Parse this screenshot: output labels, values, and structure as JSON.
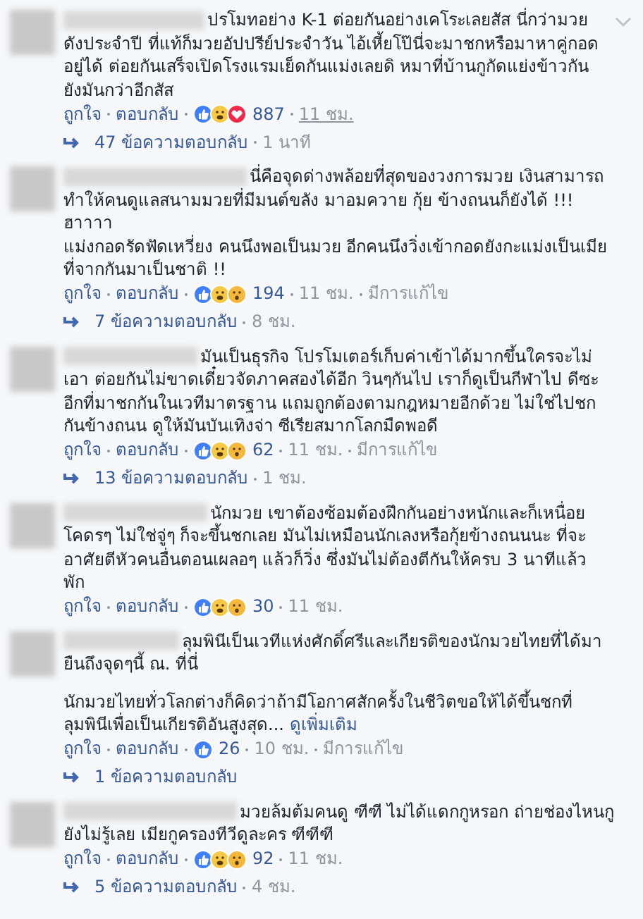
{
  "comments": [
    {
      "menu_visible": true,
      "paragraphs": [
        [
          "ปรโมทอย่าง K-1 ต่อยกันอย่างเคโระเลยสัส นี่กว่ามวย",
          "ดังประจำปี ที่แท้ก็มวยอัปปรีย์ประจำวัน ไอ้เหี้ยโป๊นี่จะมาชกหรือมาหาคู่กอด",
          "อยู่ได้ ต่อยกันเสร็จเปิดโรงแรมเย็ดกันแม่งเลยดิ หมาที่บ้านกูกัดแย่งข้าวกัน",
          "ยังมันกว่าอีกสัส"
        ]
      ],
      "like": "ถูกใจ",
      "reply": "ตอบกลับ",
      "reactions": [
        {
          "kind": "like"
        },
        {
          "kind": "haha"
        },
        {
          "kind": "love"
        }
      ],
      "count": "887",
      "time": "11 ชม.",
      "time_hovered": true,
      "replies": "47 ข้อความตอบกลับ",
      "replies_time": "1 นาที"
    },
    {
      "menu_visible": false,
      "paragraphs": [
        [
          "นี่คือจุดด่างพล้อยที่สุดของวงการมวย เงินสามารถ",
          "ทำให้คนดูแลสนามมวยที่มีมนต์ขลัง มาอมควาย กุ้ย ข้างถนนก็ยังได้ !!!",
          "ฮาาาา",
          "แม่งกอดรัดฟัดเหวี่ยง คนนึงพอเป็นมวย อีกคนนึงวิ่งเข้ากอดยังกะแม่งเป็นเมีย",
          "ที่จากกันมาเป็นชาติ !!"
        ]
      ],
      "like": "ถูกใจ",
      "reply": "ตอบกลับ",
      "reactions": [
        {
          "kind": "like"
        },
        {
          "kind": "haha"
        },
        {
          "kind": "wow"
        }
      ],
      "count": "194",
      "time": "11 ชม.",
      "time_hovered": false,
      "edited": "มีการแก้ไข",
      "replies": "7 ข้อความตอบกลับ",
      "replies_time": "8 ชม."
    },
    {
      "menu_visible": false,
      "paragraphs": [
        [
          "มันเป็นธุรกิจ โปรโมเตอร์เก็บค่าเข้าได้มากขึ้นใครจะไม่",
          "เอา ต่อยกันไม่ขาดเดี๋ยวจัดภาคสองได้อีก วินๆกันไป เราก็ดูเป็นกีฬาไป ดีซะ",
          "อีกที่มาชกกันในเวทีมาตรฐาน แถมถูกต้องตามกฎหมายอีกด้วย ไม่ใช่ไปชก",
          "กันข้างถนน ดูให้มันบันเทิงจ่า ซีเรียสมากโลกมืดพอดี"
        ]
      ],
      "like": "ถูกใจ",
      "reply": "ตอบกลับ",
      "reactions": [
        {
          "kind": "like"
        },
        {
          "kind": "haha"
        },
        {
          "kind": "wow"
        }
      ],
      "count": "62",
      "time": "11 ชม.",
      "time_hovered": false,
      "edited": "มีการแก้ไข",
      "replies": "13 ข้อความตอบกลับ",
      "replies_time": "1 ชม."
    },
    {
      "menu_visible": false,
      "paragraphs": [
        [
          "นักมวย เขาต้องซ้อมต้องฝึกกันอย่างหนักและก็เหนื่อย",
          "โคดรๆ ไม่ใช่จู่ๆ ก็จะขึ้นชกเลย มันไม่เหมือนนักเลงหรือกุ้ยข้างถนนนะ ที่จะ",
          "อาศัยตีหัวคนอื่นตอนเผลอๆ แล้วก็วิ่ง ซึ่งมันไม่ต้องตีกันให้ครบ 3 นาทีแล้ว",
          "พัก"
        ]
      ],
      "like": "ถูกใจ",
      "reply": "ตอบกลับ",
      "reactions": [
        {
          "kind": "like"
        },
        {
          "kind": "haha"
        },
        {
          "kind": "wow"
        }
      ],
      "count": "30",
      "time": "11 ชม.",
      "time_hovered": false
    },
    {
      "menu_visible": false,
      "paragraphs": [
        [
          "ลุมพินีเป็นเวทีแห่งศักดิ์ศรีและเกียรติของนักมวยไทยที่ได้มา",
          "ยืนถึงจุดๆนี้ ณ. ที่นี่"
        ],
        [
          "นักมวยไทยทั่วโลกต่างก็คิดว่าถ้ามีโอกาศสักครั้งในชีวิตขอให้ได้ขึ้นชกที่",
          "ลุมพินีเพื่อเป็นเกียรติอันสูงสุด..."
        ]
      ],
      "see_more": "ดูเพิ่มเติม",
      "like": "ถูกใจ",
      "reply": "ตอบกลับ",
      "reactions": [
        {
          "kind": "like"
        }
      ],
      "count": "26",
      "time": "10 ชม.",
      "time_hovered": false,
      "edited": "มีการแก้ไข",
      "replies": "1 ข้อความตอบกลับ"
    },
    {
      "menu_visible": false,
      "paragraphs": [
        [
          "มวยล้มต้มคนดู ฑีฑี ไม่ได้แดกกูหรอก ถ่ายช่องไหนกู",
          "ยังไม่รู้เลย เมียกูครองทีวีดูละคร ฑีฑีฑี"
        ]
      ],
      "like": "ถูกใจ",
      "reply": "ตอบกลับ",
      "reactions": [
        {
          "kind": "like"
        },
        {
          "kind": "haha"
        },
        {
          "kind": "wow"
        }
      ],
      "count": "92",
      "time": "11 ชม.",
      "time_hovered": false,
      "replies": "5 ข้อความตอบกลับ",
      "replies_time": "4 ชม."
    }
  ]
}
